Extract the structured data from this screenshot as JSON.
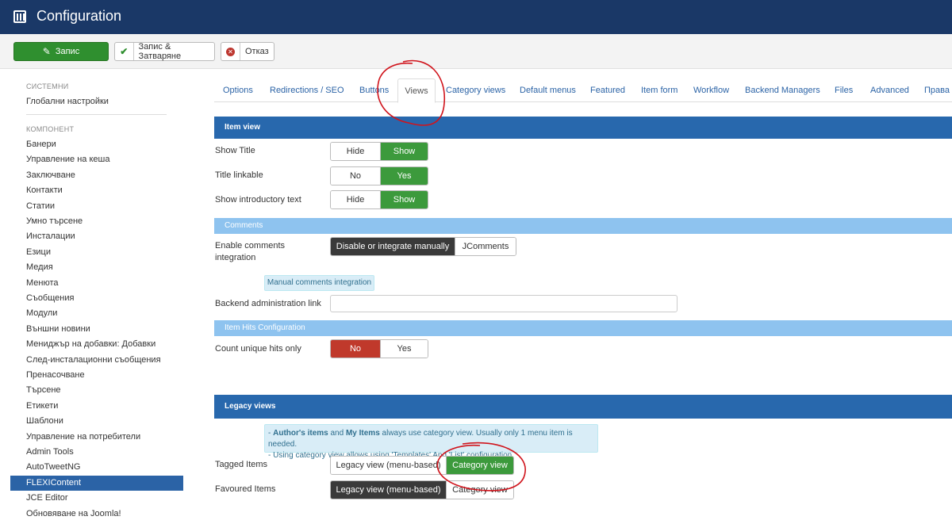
{
  "header": {
    "title": "Configuration"
  },
  "toolbar": {
    "save_label": "Запис",
    "save_close_label": "Запис & Затваряне",
    "cancel_label": "Отказ"
  },
  "sidebar": {
    "system_heading": "СИСТЕМНИ",
    "system_items": [
      "Глобални настройки"
    ],
    "component_heading": "КОМПОНЕНТ",
    "component_items": [
      "Банери",
      "Управление на кеша",
      "Заключване",
      "Контакти",
      "Статии",
      "Умно търсене",
      "Инсталации",
      "Езици",
      "Медия",
      "Менюта",
      "Съобщения",
      "Модули",
      "Външни новини",
      "Мениджър на добавки: Добавки",
      "След-инсталационни съобщения",
      "Пренасочване",
      "Търсене",
      "Етикети",
      "Шаблони",
      "Управление на потребители",
      "Admin Tools",
      "AutoTweetNG",
      "FLEXIContent",
      "JCE Editor",
      "Обновяване на Joomla!"
    ],
    "active_item": "FLEXIContent"
  },
  "tabs": [
    "Options",
    "Redirections / SEO",
    "Buttons",
    "Views",
    "Category views",
    "Default menus",
    "Featured",
    "Item form",
    "Workflow",
    "Backend Managers",
    "Files",
    "Advanced",
    "Права"
  ],
  "active_tab": "Views",
  "sections": {
    "item_view": "Item view",
    "comments": "Comments",
    "item_hits": "Item Hits Configuration",
    "legacy_views": "Legacy views"
  },
  "fields": {
    "show_title": {
      "label": "Show Title",
      "options": [
        "Hide",
        "Show"
      ],
      "selected": "Show"
    },
    "title_linkable": {
      "label": "Title linkable",
      "options": [
        "No",
        "Yes"
      ],
      "selected": "Yes"
    },
    "show_intro": {
      "label": "Show introductory text",
      "options": [
        "Hide",
        "Show"
      ],
      "selected": "Show"
    },
    "enable_comments": {
      "label_line1": "Enable comments",
      "label_line2": "integration",
      "options": [
        "Disable or integrate manually",
        "JComments"
      ],
      "selected": "Disable or integrate manually"
    },
    "manual_comments_note": "Manual comments integration",
    "backend_admin_link": {
      "label": "Backend administration link",
      "value": ""
    },
    "count_unique_hits": {
      "label": "Count unique hits only",
      "options": [
        "No",
        "Yes"
      ],
      "selected": "No"
    },
    "tagged_items": {
      "label": "Tagged Items",
      "options": [
        "Legacy view (menu-based)",
        "Category view"
      ],
      "selected": "Category view"
    },
    "favoured_items": {
      "label": "Favoured Items",
      "options": [
        "Legacy view (menu-based)",
        "Category view"
      ],
      "selected": "Legacy view (menu-based)"
    }
  },
  "legacy_note": {
    "line1_prefix": "- ",
    "line1_bold1": "Author's items",
    "line1_mid": " and ",
    "line1_bold2": "My Items",
    "line1_rest": " always use category view. Usually only 1 menu item is needed.",
    "line2": "- Using category view allows using 'Templates' And 'List' configuration"
  },
  "colors": {
    "header": "#1a3867",
    "accent": "#2868ad",
    "green": "#3c9a3c",
    "red": "#c0392b",
    "annotation": "#d0141c"
  }
}
